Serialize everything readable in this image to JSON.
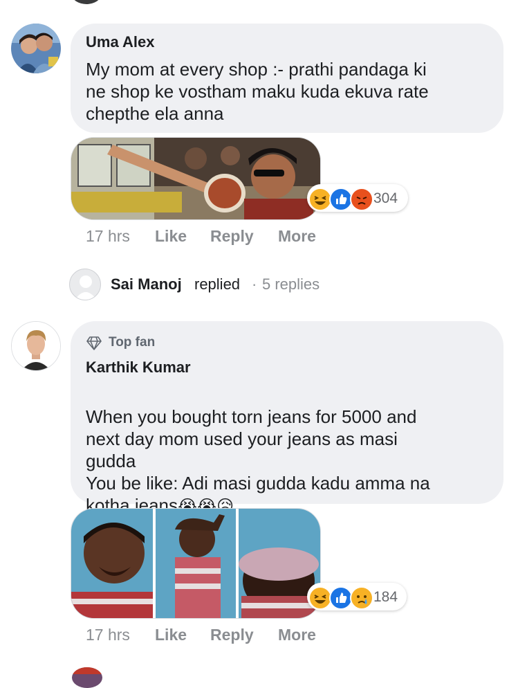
{
  "comments": [
    {
      "author": "Uma Alex",
      "text": "My mom at every shop :- prathi pandaga ki\nne shop ke vostham maku kuda ekuva rate\nchepthe ela anna",
      "reaction_count": "304",
      "time": "17 hrs",
      "actions": [
        "Like",
        "Reply",
        "More"
      ],
      "reactions": [
        "haha-icon",
        "like-icon",
        "angry-icon"
      ]
    },
    {
      "badge": "Top fan",
      "author": "Karthik Kumar",
      "text": "When you bought torn jeans for 5000 and\nnext day mom used your jeans as masi\ngudda\nYou be like: Adi masi gudda kadu amma na\nkotha jeans",
      "text_emojis": "😭😭😥",
      "reaction_count": "184",
      "time": "17 hrs",
      "actions": [
        "Like",
        "Reply",
        "More"
      ],
      "reactions": [
        "haha-icon",
        "like-icon",
        "sad-icon"
      ]
    }
  ],
  "reply_summary": {
    "name": "Sai Manoj",
    "verb": "replied",
    "separator": "·",
    "count": "5 replies"
  }
}
